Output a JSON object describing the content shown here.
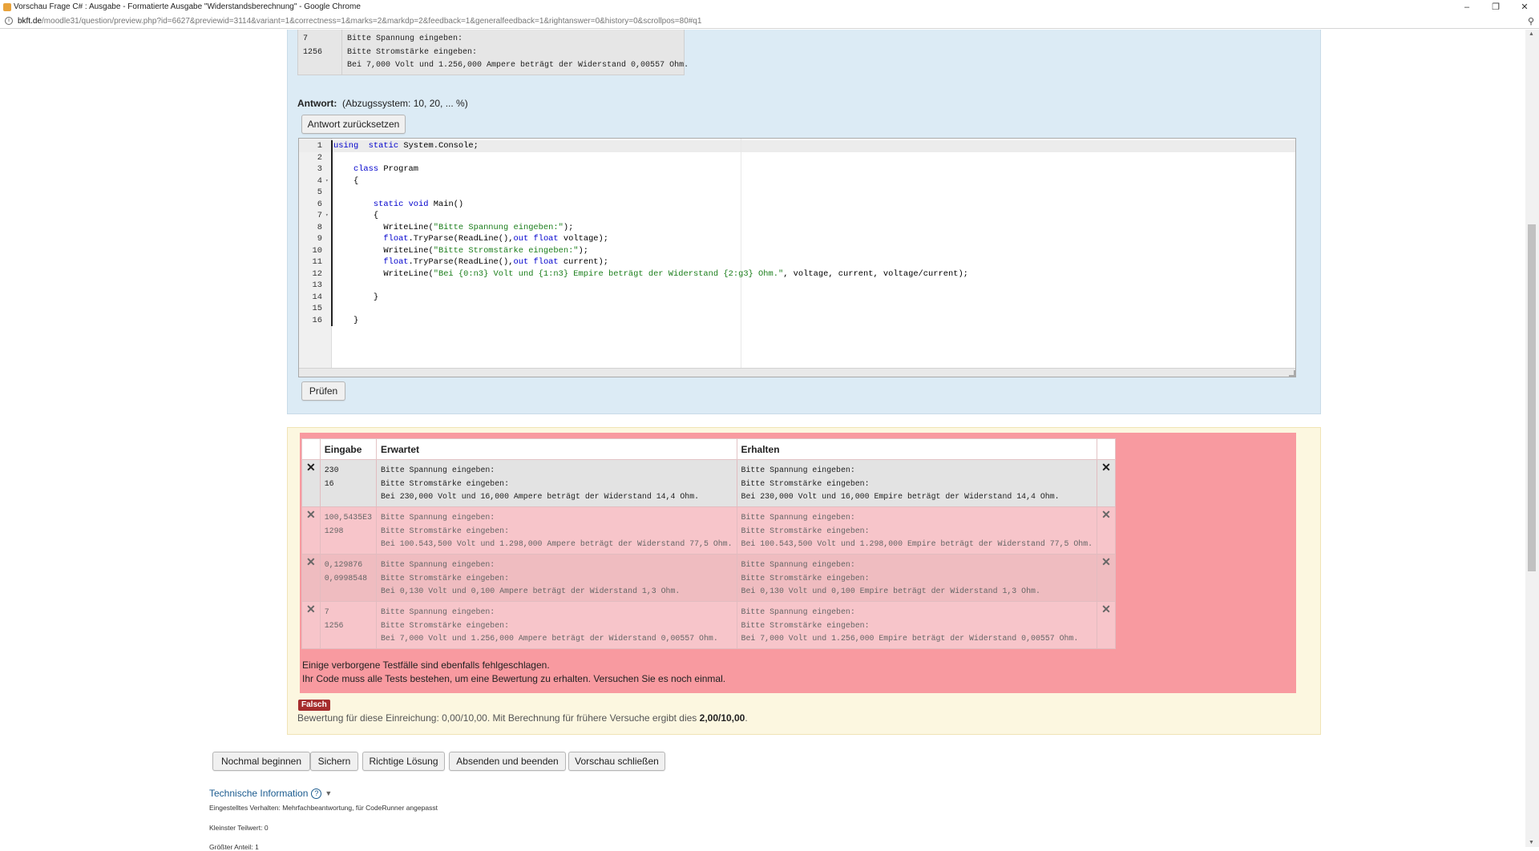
{
  "browser": {
    "window_title": "Vorschau Frage C# : Ausgabe - Formatierte Ausgabe \"Widerstandsberechnung\" - Google Chrome",
    "url_host": "bkft.de",
    "url_path": "/moodle31/question/preview.php?id=6627&previewid=3114&variant=1&correctness=1&marks=2&markdp=2&feedback=1&generalfeedback=1&rightanswer=0&history=0&scrollpos=80#q1",
    "window_buttons": [
      "–",
      "❐",
      "✕"
    ]
  },
  "example": {
    "inputs": [
      "7",
      "1256"
    ],
    "outputs": [
      "Bitte Spannung eingeben:",
      "Bitte Stromstärke eingeben:",
      "Bei 7,000 Volt und 1.256,000 Ampere beträgt der Widerstand 0,00557 Ohm."
    ]
  },
  "answer": {
    "label": "Antwort:",
    "penalty": "(Abzugssystem: 10, 20, ... %)",
    "reset_button": "Antwort zurücksetzen",
    "check_button": "Prüfen"
  },
  "code_lines": [
    {
      "n": "1",
      "fold": "",
      "parts": [
        [
          "kw",
          "using"
        ],
        [
          "",
          "  "
        ],
        [
          "kw",
          "static"
        ],
        [
          "",
          " System.Console;"
        ]
      ]
    },
    {
      "n": "2",
      "fold": "",
      "parts": []
    },
    {
      "n": "3",
      "fold": "",
      "parts": [
        [
          "",
          "    "
        ],
        [
          "kw",
          "class"
        ],
        [
          "",
          " Program"
        ]
      ]
    },
    {
      "n": "4",
      "fold": "▾",
      "parts": [
        [
          "",
          "    {"
        ]
      ]
    },
    {
      "n": "5",
      "fold": "",
      "parts": []
    },
    {
      "n": "6",
      "fold": "",
      "parts": [
        [
          "",
          "        "
        ],
        [
          "kw",
          "static"
        ],
        [
          "",
          " "
        ],
        [
          "kw",
          "void"
        ],
        [
          "",
          " Main()"
        ]
      ]
    },
    {
      "n": "7",
      "fold": "▾",
      "parts": [
        [
          "",
          "        {"
        ]
      ]
    },
    {
      "n": "8",
      "fold": "",
      "parts": [
        [
          "",
          "          WriteLine("
        ],
        [
          "str",
          "\"Bitte Spannung eingeben:\""
        ],
        [
          "",
          ");"
        ]
      ]
    },
    {
      "n": "9",
      "fold": "",
      "parts": [
        [
          "",
          "          "
        ],
        [
          "kw",
          "float"
        ],
        [
          "",
          ".TryParse(ReadLine(),"
        ],
        [
          "kw",
          "out"
        ],
        [
          "",
          " "
        ],
        [
          "kw",
          "float"
        ],
        [
          "",
          " voltage);"
        ]
      ]
    },
    {
      "n": "10",
      "fold": "",
      "parts": [
        [
          "",
          "          WriteLine("
        ],
        [
          "str",
          "\"Bitte Stromstärke eingeben:\""
        ],
        [
          "",
          ");"
        ]
      ]
    },
    {
      "n": "11",
      "fold": "",
      "parts": [
        [
          "",
          "          "
        ],
        [
          "kw",
          "float"
        ],
        [
          "",
          ".TryParse(ReadLine(),"
        ],
        [
          "kw",
          "out"
        ],
        [
          "",
          " "
        ],
        [
          "kw",
          "float"
        ],
        [
          "",
          " current);"
        ]
      ]
    },
    {
      "n": "12",
      "fold": "",
      "parts": [
        [
          "",
          "          WriteLine("
        ],
        [
          "str",
          "\"Bei {0:n3} Volt und {1:n3} Empire beträgt der Widerstand {2:g3} Ohm.\""
        ],
        [
          "",
          ", voltage, current, voltage/current);"
        ]
      ]
    },
    {
      "n": "13",
      "fold": "",
      "parts": []
    },
    {
      "n": "14",
      "fold": "",
      "parts": [
        [
          "",
          "        }"
        ]
      ]
    },
    {
      "n": "15",
      "fold": "",
      "parts": []
    },
    {
      "n": "16",
      "fold": "",
      "parts": [
        [
          "",
          "    }"
        ]
      ]
    }
  ],
  "results": {
    "headers": {
      "mark": "",
      "input": "Eingabe",
      "expected": "Erwartet",
      "got": "Erhalten",
      "mark2": ""
    },
    "rows": [
      {
        "input": [
          "230",
          "16"
        ],
        "expected": [
          "Bitte Spannung eingeben:",
          "Bitte Stromstärke eingeben:",
          "Bei 230,000 Volt und 16,000 Ampere beträgt der Widerstand 14,4 Ohm."
        ],
        "got": [
          "Bitte Spannung eingeben:",
          "Bitte Stromstärke eingeben:",
          "Bei 230,000 Volt und 16,000 Empire beträgt der Widerstand 14,4 Ohm."
        ]
      },
      {
        "input": [
          "100,5435E3",
          "1298"
        ],
        "expected": [
          "Bitte Spannung eingeben:",
          "Bitte Stromstärke eingeben:",
          "Bei 100.543,500 Volt und 1.298,000 Ampere beträgt der Widerstand 77,5 Ohm."
        ],
        "got": [
          "Bitte Spannung eingeben:",
          "Bitte Stromstärke eingeben:",
          "Bei 100.543,500 Volt und 1.298,000 Empire beträgt der Widerstand 77,5 Ohm."
        ]
      },
      {
        "input": [
          "0,129876",
          "0,0998548"
        ],
        "expected": [
          "Bitte Spannung eingeben:",
          "Bitte Stromstärke eingeben:",
          "Bei 0,130 Volt und 0,100 Ampere beträgt der Widerstand 1,3 Ohm."
        ],
        "got": [
          "Bitte Spannung eingeben:",
          "Bitte Stromstärke eingeben:",
          "Bei 0,130 Volt und 0,100 Empire beträgt der Widerstand 1,3 Ohm."
        ]
      },
      {
        "input": [
          "7",
          "1256"
        ],
        "expected": [
          "Bitte Spannung eingeben:",
          "Bitte Stromstärke eingeben:",
          "Bei 7,000 Volt und 1.256,000 Ampere beträgt der Widerstand 0,00557 Ohm."
        ],
        "got": [
          "Bitte Spannung eingeben:",
          "Bitte Stromstärke eingeben:",
          "Bei 7,000 Volt und 1.256,000 Empire beträgt der Widerstand 0,00557 Ohm."
        ]
      }
    ],
    "fail_mark": "✕",
    "message_line1": "Einige verborgene Testfälle sind ebenfalls fehlgeschlagen.",
    "message_line2": "Ihr Code muss alle Tests bestehen, um eine Bewertung zu erhalten. Versuchen Sie es noch einmal."
  },
  "status": {
    "badge": "Falsch",
    "grade_prefix": "Bewertung für diese Einreichung: 0,00/10,00. Mit Berechnung für frühere Versuche ergibt dies ",
    "grade_value": "2,00/10,00",
    "grade_suffix": "."
  },
  "actions": [
    "Nochmal beginnen",
    "Sichern",
    "Richtige Lösung",
    "Absenden und beenden",
    "Vorschau schließen"
  ],
  "tech": {
    "title": "Technische Information",
    "behaviour": "Eingestelltes Verhalten: Mehrfachbeantwortung, für CodeRunner angepasst",
    "min_fraction": "Kleinster Teilwert: 0",
    "max_fraction": "Größter Anteil: 1"
  },
  "colors": {
    "question_bg": "#dcebf5",
    "result_bg": "#fcf7e0",
    "fail_bg": "#f89aa0",
    "fail_badge": "#a52d2d",
    "link": "#1b5b8f"
  }
}
